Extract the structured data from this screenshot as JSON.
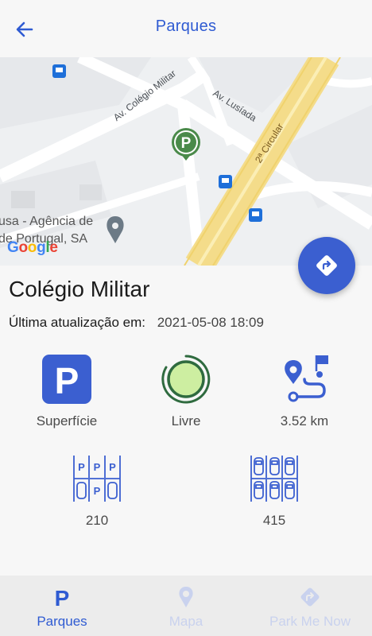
{
  "header": {
    "title": "Parques",
    "back_icon": "arrow-left-icon"
  },
  "map": {
    "streets": [
      "Av. Colégio Militar",
      "Av. Lusíada",
      "2ª Circular"
    ],
    "place_label_line1": "usa - Agência de",
    "place_label_line2": "de Portugal, SA",
    "logo_letters": [
      "G",
      "o",
      "o",
      "g",
      "l",
      "e"
    ],
    "logo_colors": [
      "#4285F4",
      "#EA4335",
      "#FBBC05",
      "#4285F4",
      "#34A853",
      "#EA4335"
    ],
    "marker_icon": "parking-marker-icon"
  },
  "fab": {
    "icon": "directions-icon"
  },
  "park": {
    "name": "Colégio Militar",
    "update_label": "Última atualização em:",
    "update_value": "2021-05-08 18:09"
  },
  "stats": {
    "type": {
      "label": "Superfície",
      "icon": "parking-p-icon"
    },
    "status": {
      "label": "Livre",
      "icon": "availability-circle-icon"
    },
    "distance": {
      "label": "3.52 km",
      "icon": "route-icon"
    },
    "spaces_paid": {
      "label": "210",
      "icon": "paid-spaces-icon"
    },
    "spaces_total": {
      "label": "415",
      "icon": "car-spaces-icon"
    }
  },
  "bottom_nav": [
    {
      "label": "Parques",
      "icon": "parking-nav-icon",
      "active": true
    },
    {
      "label": "Mapa",
      "icon": "map-pin-icon",
      "active": false
    },
    {
      "label": "Park Me Now",
      "icon": "directions-nav-icon",
      "active": false
    }
  ],
  "colors": {
    "accent": "#2f5bd2",
    "fab": "#3b5fd0",
    "status_green": "#2f6b3f",
    "status_fill": "#cdeea1",
    "nav_inactive": "#c9d2ee"
  }
}
